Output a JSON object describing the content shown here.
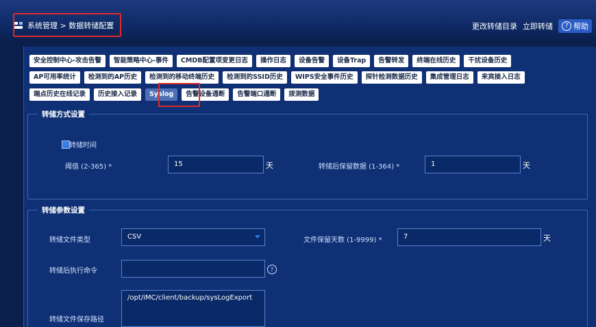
{
  "breadcrumb": {
    "text": "系统管理 > 数据转储配置"
  },
  "top_actions": {
    "change_dir": "更改转储目录",
    "dump_now": "立即转储",
    "help": "帮助"
  },
  "tabs": {
    "row1": [
      "安全控制中心-攻击告警",
      "智能策略中心-事件",
      "CMDB配置项变更日志",
      "操作日志",
      "设备告警",
      "设备Trap",
      "告警转发",
      "终端在线历史",
      "干扰设备历史"
    ],
    "row2": [
      "AP可用率统计",
      "检测到的AP历史",
      "检测到的移动终端历史",
      "检测到的SSID历史",
      "WIPS安全事件历史",
      "探针检测数据历史",
      "集成管理日志",
      "来宾接入日志"
    ],
    "row3": [
      "端点历史在线记录",
      "历史接入记录",
      "Syslog",
      "告警设备通断",
      "告警端口通断",
      "拨测数据"
    ],
    "active": "Syslog"
  },
  "dump_method": {
    "legend": "转储方式设置",
    "checkbox_label": "转储时间",
    "threshold_label": "阈值 (2-365)",
    "threshold_value": "15",
    "threshold_unit": "天",
    "retain_label": "转储后保留数据 (1-364)",
    "retain_value": "1",
    "retain_unit": "天",
    "required_mark": "*"
  },
  "dump_params": {
    "legend": "转储参数设置",
    "filetype_label": "转储文件类型",
    "filetype_value": "CSV",
    "keep_days_label": "文件保留天数 (1-9999)",
    "keep_days_value": "7",
    "keep_days_unit": "天",
    "post_cmd_label": "转储后执行命令",
    "post_cmd_value": "",
    "save_path_label": "转储文件保存路径",
    "save_path_value": "/opt/iMC/client/backup/sysLogExport",
    "required_mark": "*",
    "help_glyph": "?"
  },
  "colors": {
    "highlight": "#e02a2a",
    "background": "#0b1f4d",
    "panel": "#0f3074"
  }
}
